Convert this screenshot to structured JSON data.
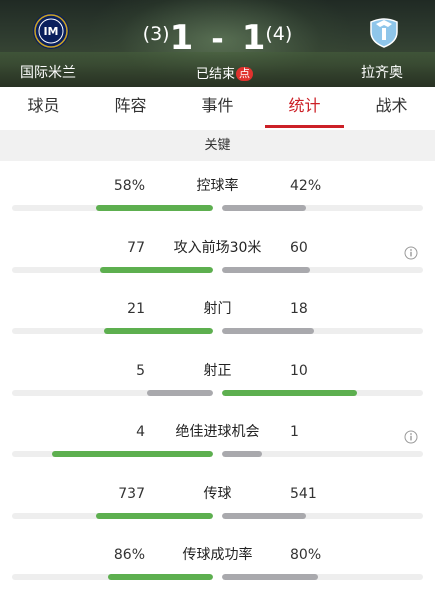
{
  "match": {
    "home_team": "国际米兰",
    "away_team": "拉齐奥",
    "home_pen": "(3)",
    "away_pen": "(4)",
    "home_score": "1",
    "away_score": "1",
    "separator": "-",
    "status": "已结束",
    "status_badge": "点"
  },
  "tabs": [
    {
      "label": "球员",
      "active": false
    },
    {
      "label": "阵容",
      "active": false
    },
    {
      "label": "事件",
      "active": false
    },
    {
      "label": "统计",
      "active": true
    },
    {
      "label": "战术",
      "active": false
    }
  ],
  "section": {
    "title": "关键"
  },
  "colors": {
    "winner": "#5daf4f",
    "other": "#a9a9ad",
    "accent": "#cc2027"
  },
  "stats": [
    {
      "name": "控球率",
      "left": "58%",
      "right": "42%",
      "left_ratio": 0.58,
      "right_ratio": 0.42,
      "leader": "left",
      "info": false
    },
    {
      "name": "攻入前场30米",
      "left": "77",
      "right": "60",
      "left_ratio": 0.56,
      "right_ratio": 0.44,
      "leader": "left",
      "info": true
    },
    {
      "name": "射门",
      "left": "21",
      "right": "18",
      "left_ratio": 0.54,
      "right_ratio": 0.46,
      "leader": "left",
      "info": false
    },
    {
      "name": "射正",
      "left": "5",
      "right": "10",
      "left_ratio": 0.33,
      "right_ratio": 0.67,
      "leader": "right",
      "info": false
    },
    {
      "name": "绝佳进球机会",
      "left": "4",
      "right": "1",
      "left_ratio": 0.8,
      "right_ratio": 0.2,
      "leader": "left",
      "info": true
    },
    {
      "name": "传球",
      "left": "737",
      "right": "541",
      "left_ratio": 0.58,
      "right_ratio": 0.42,
      "leader": "left",
      "info": false
    },
    {
      "name": "传球成功率",
      "left": "86%",
      "right": "80%",
      "left_ratio": 0.52,
      "right_ratio": 0.48,
      "leader": "left",
      "info": false
    }
  ]
}
